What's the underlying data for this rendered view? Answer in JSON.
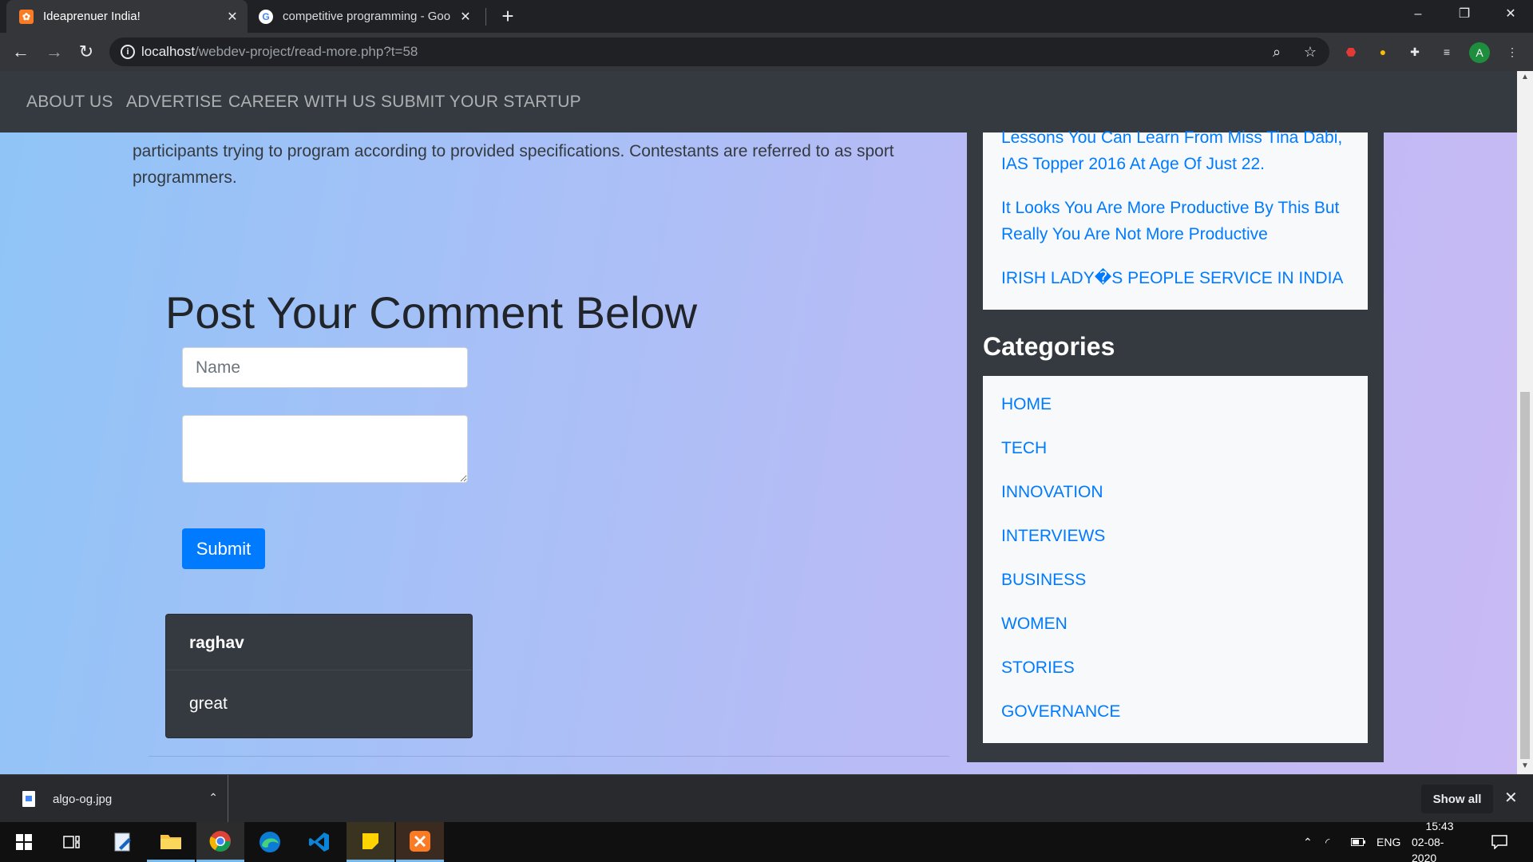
{
  "browser": {
    "tabs": [
      {
        "title": "Ideaprenuer India!",
        "active": true
      },
      {
        "title": "competitive programming - Goo",
        "active": false
      }
    ],
    "new_tab": "+",
    "window_controls": {
      "minimize": "–",
      "restore": "❐",
      "close": "✕"
    },
    "nav": {
      "back": "←",
      "forward": "→",
      "reload": "↻"
    },
    "url_host": "localhost",
    "url_path": "/webdev-project/read-more.php?t=58",
    "profile_initial": "A"
  },
  "site": {
    "nav_links": [
      "ABOUT US",
      "ADVERTISE",
      "CAREER WITH US",
      "SUBMIT YOUR STARTUP"
    ],
    "intro_text": "participants trying to program according to provided specifications. Contestants are referred to as sport programmers.",
    "comment_heading": "Post Your Comment Below",
    "name_placeholder": "Name",
    "submit_label": "Submit",
    "comment": {
      "author": "raghav",
      "text": "great"
    },
    "recent_posts": [
      "Lessons You Can Learn From Miss Tina Dabi, IAS Topper 2016 At Age Of Just 22.",
      "It Looks You Are More Productive By This But Really You Are Not More Productive",
      "IRISH LADY�S PEOPLE SERVICE IN INDIA"
    ],
    "categories_title": "Categories",
    "categories": [
      "HOME",
      "TECH",
      "INNOVATION",
      "INTERVIEWS",
      "BUSINESS",
      "WOMEN",
      "STORIES",
      "GOVERNANCE"
    ]
  },
  "downloads": {
    "file": "algo-og.jpg",
    "show_all": "Show all",
    "close": "✕"
  },
  "taskbar": {
    "language": "ENG",
    "time": "15:43",
    "date": "02-08-2020"
  },
  "colors": {
    "link": "#007bff",
    "navbar": "#343a40",
    "submit": "#007bff"
  }
}
